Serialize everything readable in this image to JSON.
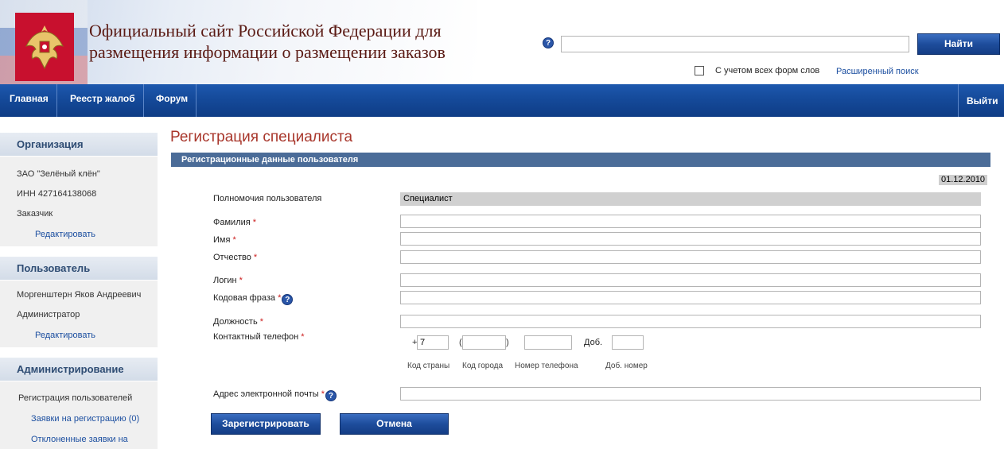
{
  "header": {
    "site_title_line1": "Официальный сайт Российской Федерации для",
    "site_title_line2": "размещения информации о размещении заказов",
    "search_value": "",
    "search_button": "Найти",
    "wordforms_label": "С учетом всех форм слов",
    "advanced_search": "Расширенный поиск"
  },
  "nav": {
    "home": "Главная",
    "complaints": "Реестр жалоб",
    "forum": "Форум",
    "logout": "Выйти"
  },
  "sidebar": {
    "organization": {
      "title": "Организация",
      "name": "ЗАО \"Зелёный клён\"",
      "inn": "ИНН 427164138068",
      "role": "Заказчик",
      "edit": "Редактировать"
    },
    "user": {
      "title": "Пользователь",
      "name": "Моргенштерн Яков Андреевич",
      "role": "Администратор",
      "edit": "Редактировать"
    },
    "admin": {
      "title": "Администрирование",
      "registration": "Регистрация пользователей",
      "applications": "Заявки на регистрацию (0)",
      "rejected": "Отклоненные заявки на"
    }
  },
  "main": {
    "page_title": "Регистрация специалиста",
    "section_title": "Регистрационные данные пользователя",
    "date": "01.12.2010",
    "authority_label": "Полномочия пользователя",
    "authority_value": "Специалист",
    "required_mark": "*",
    "lastname_label": "Фамилия",
    "firstname_label": "Имя",
    "patronymic_label": "Отчество",
    "login_label": "Логин",
    "codephrase_label": "Кодовая фраза",
    "position_label": "Должность",
    "phone_label": "Контактный телефон",
    "phone_plus": "+",
    "phone_country_value": "7",
    "paren_open": "(",
    "paren_close": ")",
    "ext_label": "Доб.",
    "hint_country": "Код страны",
    "hint_city": "Код города",
    "hint_number": "Номер телефона",
    "hint_ext": "Доб. номер",
    "email_label": "Адрес электронной почты",
    "submit_button": "Зарегистрировать",
    "cancel_button": "Отмена",
    "help_glyph": "?"
  }
}
